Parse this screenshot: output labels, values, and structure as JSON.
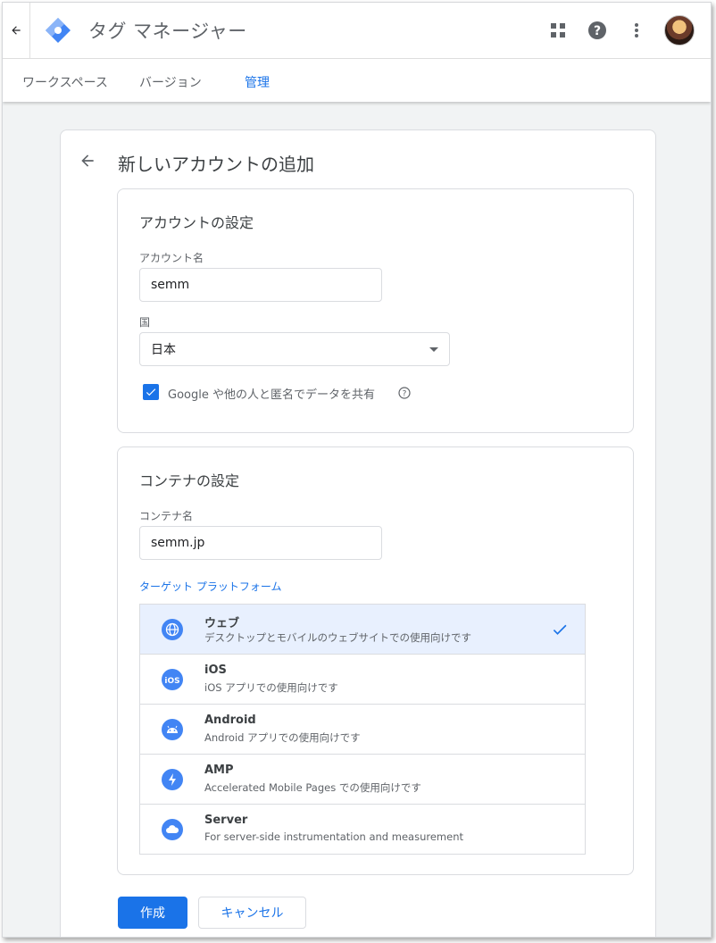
{
  "app": {
    "title": "タグ マネージャー"
  },
  "tabs": [
    {
      "label": "ワークスペース",
      "active": false
    },
    {
      "label": "バージョン",
      "active": false
    },
    {
      "label": "管理",
      "active": true
    }
  ],
  "page": {
    "title": "新しいアカウントの追加"
  },
  "account_section": {
    "title": "アカウントの設定",
    "account_name_label": "アカウント名",
    "account_name_value": "semm",
    "country_label": "国",
    "country_value": "日本",
    "share_label": "Google や他の人と匿名でデータを共有",
    "share_checked": true
  },
  "container_section": {
    "title": "コンテナの設定",
    "container_name_label": "コンテナ名",
    "container_name_value": "semm.jp",
    "platform_label": "ターゲット プラットフォーム",
    "platforms": [
      {
        "name": "ウェブ",
        "desc": "デスクトップとモバイルのウェブサイトでの使用向けです",
        "icon": "globe-icon",
        "selected": true
      },
      {
        "name": "iOS",
        "desc": "iOS アプリでの使用向けです",
        "icon": "ios-icon",
        "selected": false
      },
      {
        "name": "Android",
        "desc": "Android アプリでの使用向けです",
        "icon": "android-icon",
        "selected": false
      },
      {
        "name": "AMP",
        "desc": "Accelerated Mobile Pages での使用向けです",
        "icon": "bolt-icon",
        "selected": false
      },
      {
        "name": "Server",
        "desc": "For server-side instrumentation and measurement",
        "icon": "cloud-icon",
        "selected": false
      }
    ]
  },
  "buttons": {
    "create": "作成",
    "cancel": "キャンセル"
  },
  "colors": {
    "accent": "#1a73e8",
    "selected_bg": "#e8f0fe",
    "icon_blue": "#4285f4"
  }
}
